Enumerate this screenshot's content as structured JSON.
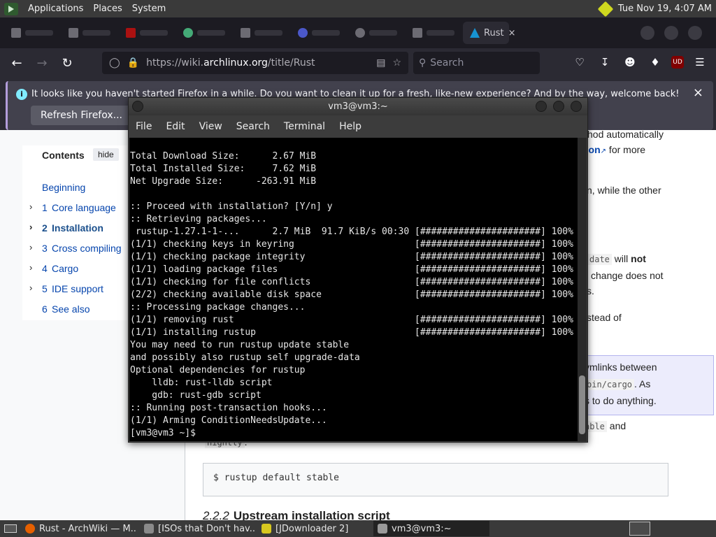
{
  "top_panel": {
    "menus": [
      "Applications",
      "Places",
      "System"
    ],
    "clock": "Tue Nov 19,  4:07 AM"
  },
  "browser": {
    "active_tab_title": "Rust",
    "tab_close": "×",
    "url_prefix": "https://wiki.",
    "url_host": "archlinux.org",
    "url_path": "/title/Rust",
    "search_placeholder": "Search",
    "ublock_badge": "UD"
  },
  "notification": {
    "message": "It looks like you haven't started Firefox in a while. Do you want to clean it up for a fresh, like-new experience? And by the way, welcome back!",
    "button": "Refresh Firefox...",
    "close": "×"
  },
  "toc": {
    "heading": "Contents",
    "hide": "hide",
    "items": [
      {
        "num": "",
        "label": "Beginning",
        "expandable": false
      },
      {
        "num": "1",
        "label": "Core language",
        "expandable": true
      },
      {
        "num": "2",
        "label": "Installation",
        "expandable": true
      },
      {
        "num": "3",
        "label": "Cross compiling",
        "expandable": true
      },
      {
        "num": "4",
        "label": "Cargo",
        "expandable": true
      },
      {
        "num": "5",
        "label": "IDE support",
        "expandable": true
      },
      {
        "num": "6",
        "label": "See also",
        "expandable": false
      }
    ]
  },
  "article": {
    "frag_method": "hod automatically",
    "frag_link": "tion",
    "frag_formore": " for more",
    "frag_while": "n, while the other",
    "frag_date": "date",
    "frag_will": " will ",
    "frag_not": "not",
    "frag_change": "change does not",
    "frag_s": "s.",
    "frag_instead": "stead of",
    "note_line1": "ymlinks between",
    "note_chip": "bin/cargo",
    "note_as": ". As",
    "note_line3": "s to do anything.",
    "frag_able": "able",
    "frag_and": " and",
    "frag_nightly": "nightly",
    "frag_dot": ".",
    "code": "$ rustup default stable",
    "subhead_num": "2.2.2",
    "subhead_text": "Upstream installation script"
  },
  "terminal": {
    "title": "vm3@vm3:~",
    "menu": [
      "File",
      "Edit",
      "View",
      "Search",
      "Terminal",
      "Help"
    ],
    "lines": [
      "Total Download Size:      2.67 MiB",
      "Total Installed Size:     7.62 MiB",
      "Net Upgrade Size:      -263.91 MiB",
      "",
      ":: Proceed with installation? [Y/n] y",
      ":: Retrieving packages...",
      " rustup-1.27.1-1-...      2.7 MiB  91.7 KiB/s 00:30 [######################] 100%",
      "(1/1) checking keys in keyring                      [######################] 100%",
      "(1/1) checking package integrity                    [######################] 100%",
      "(1/1) loading package files                         [######################] 100%",
      "(1/1) checking for file conflicts                   [######################] 100%",
      "(2/2) checking available disk space                 [######################] 100%",
      ":: Processing package changes...",
      "(1/1) removing rust                                 [######################] 100%",
      "(1/1) installing rustup                             [######################] 100%",
      "You may need to run rustup update stable",
      "and possibly also rustup self upgrade-data",
      "Optional dependencies for rustup",
      "    lldb: rust-lldb script",
      "    gdb: rust-gdb script",
      ":: Running post-transaction hooks...",
      "(1/1) Arming ConditionNeedsUpdate...",
      "[vm3@vm3 ~]$ "
    ]
  },
  "taskbar": {
    "items": [
      {
        "label": "Rust - ArchWiki — M...",
        "icon_color": "#e66000",
        "active": false
      },
      {
        "label": "[ISOs that Don't hav...",
        "icon_color": "#8a8a8a",
        "active": false
      },
      {
        "label": "[JDownloader 2]",
        "icon_color": "#d8c81f",
        "active": false
      },
      {
        "label": "vm3@vm3:~",
        "icon_color": "#9a9a9a",
        "active": true
      }
    ]
  }
}
